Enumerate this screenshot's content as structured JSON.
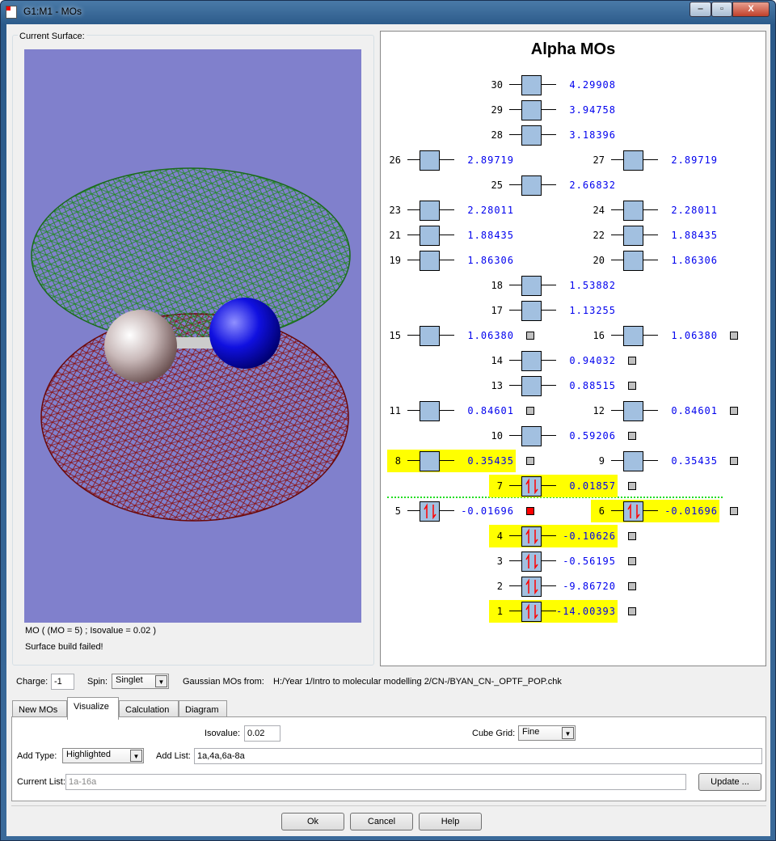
{
  "window": {
    "title": "G1:M1 - MOs",
    "minimize": "‒",
    "maximize": "▫",
    "close": "X"
  },
  "surface": {
    "group_label": "Current Surface:",
    "status_line": "MO ( (MO = 5) ; Isovalue = 0.02 )",
    "status_error": "Surface build failed!",
    "colors": {
      "background": "#8080cc",
      "positive_mesh": "#1f8a1f",
      "negative_mesh": "#8a1010",
      "atom_carbon": "#d8d0d0",
      "atom_nitrogen": "#1010e0"
    }
  },
  "diagram": {
    "title": "Alpha MOs",
    "levels": [
      [
        {
          "num": "30",
          "energy": "4.29908"
        }
      ],
      [
        {
          "num": "29",
          "energy": "3.94758"
        }
      ],
      [
        {
          "num": "28",
          "energy": "3.18396"
        }
      ],
      [
        {
          "num": "26",
          "energy": "2.89719"
        },
        {
          "num": "27",
          "energy": "2.89719"
        }
      ],
      [
        {
          "num": "25",
          "energy": "2.66832"
        }
      ],
      [
        {
          "num": "23",
          "energy": "2.28011"
        },
        {
          "num": "24",
          "energy": "2.28011"
        }
      ],
      [
        {
          "num": "21",
          "energy": "1.88435"
        },
        {
          "num": "22",
          "energy": "1.88435"
        }
      ],
      [
        {
          "num": "19",
          "energy": "1.86306"
        },
        {
          "num": "20",
          "energy": "1.86306"
        }
      ],
      [
        {
          "num": "18",
          "energy": "1.53882"
        }
      ],
      [
        {
          "num": "17",
          "energy": "1.13255"
        }
      ],
      [
        {
          "num": "15",
          "energy": "1.06380",
          "in_list": true
        },
        {
          "num": "16",
          "energy": "1.06380",
          "in_list": true
        }
      ],
      [
        {
          "num": "14",
          "energy": "0.94032",
          "in_list": true
        }
      ],
      [
        {
          "num": "13",
          "energy": "0.88515",
          "in_list": true
        }
      ],
      [
        {
          "num": "11",
          "energy": "0.84601",
          "in_list": true
        },
        {
          "num": "12",
          "energy": "0.84601",
          "in_list": true
        }
      ],
      [
        {
          "num": "10",
          "energy": "0.59206",
          "in_list": true
        }
      ],
      [
        {
          "num": "8",
          "energy": "0.35435",
          "in_list": true,
          "highlighted": true
        },
        {
          "num": "9",
          "energy": "0.35435",
          "in_list": true
        }
      ],
      [
        {
          "num": "7",
          "energy": "0.01857",
          "in_list": true,
          "highlighted": true,
          "occupied": true
        }
      ],
      [
        {
          "num": "5",
          "energy": "-0.01696",
          "in_list": true,
          "occupied": true,
          "selected": true
        },
        {
          "num": "6",
          "energy": "-0.01696",
          "in_list": true,
          "occupied": true,
          "highlighted": true
        }
      ],
      [
        {
          "num": "4",
          "energy": "-0.10626",
          "in_list": true,
          "occupied": true,
          "highlighted": true
        }
      ],
      [
        {
          "num": "3",
          "energy": "-0.56195",
          "in_list": true,
          "occupied": true
        }
      ],
      [
        {
          "num": "2",
          "energy": "-9.86720",
          "in_list": true,
          "occupied": true
        }
      ],
      [
        {
          "num": "1",
          "energy": "-14.00393",
          "in_list": true,
          "occupied": true,
          "highlighted": true
        }
      ]
    ],
    "colors": {
      "highlight": "#ffff00",
      "energy": "#0000ee",
      "orbital_box": "#a2c0e0",
      "selected_marker": "#ff0000",
      "list_marker": "#c0c0c0",
      "homo_lumo_line": "#22dd22",
      "electron_arrow": "#ff0000"
    }
  },
  "controls": {
    "charge_label": "Charge:",
    "charge_value": "-1",
    "spin_label": "Spin:",
    "spin_value": "Singlet",
    "source_label": "Gaussian MOs from:",
    "source_path": "H:/Year 1/Intro to molecular modelling 2/CN-/BYAN_CN-_OPTF_POP.chk"
  },
  "tabs": [
    {
      "label": "New MOs"
    },
    {
      "label": "Visualize",
      "active": true
    },
    {
      "label": "Calculation"
    },
    {
      "label": "Diagram"
    }
  ],
  "visualize": {
    "isovalue_label": "Isovalue:",
    "isovalue": "0.02",
    "cube_grid_label": "Cube Grid:",
    "cube_grid": "Fine",
    "add_type_label": "Add Type:",
    "add_type": "Highlighted",
    "add_list_label": "Add List:",
    "add_list": "1a,4a,6a-8a",
    "current_list_label": "Current List:",
    "current_list": "1a-16a",
    "update_button": "Update ..."
  },
  "footer": {
    "ok": "Ok",
    "cancel": "Cancel",
    "help": "Help"
  }
}
